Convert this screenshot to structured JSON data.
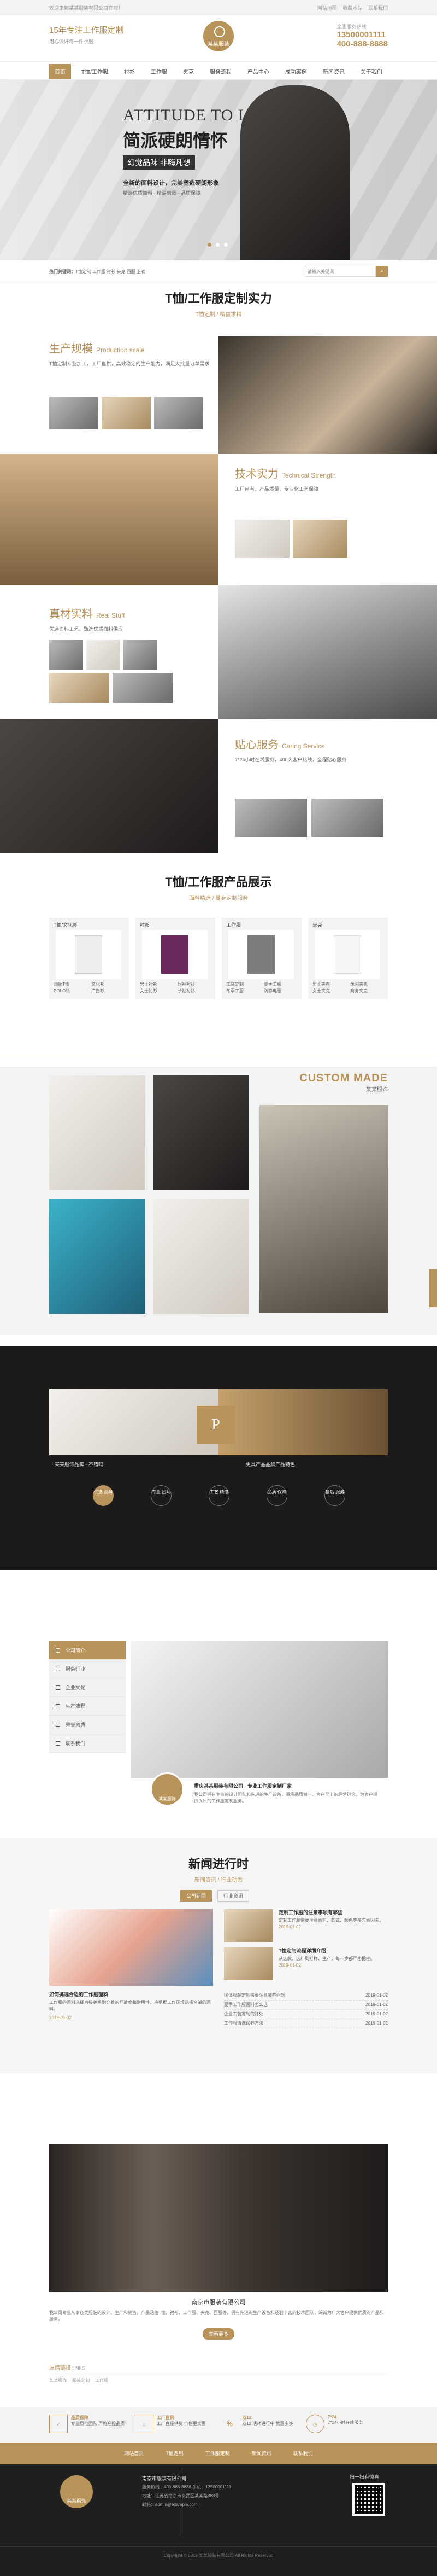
{
  "topbar": {
    "left": "欢迎来到某某服装有限公司官网！",
    "links": [
      "网站地图",
      "收藏本站",
      "联系我们"
    ]
  },
  "header": {
    "slogan": "15年专注工作服定制",
    "sub_slogan": "用心做好每一件衣服",
    "logo_text": "某某服装",
    "hotline_label": "全国服务热线",
    "phone1": "13500001111",
    "phone2": "400-888-8888"
  },
  "nav": {
    "items": [
      "首页",
      "T恤/工作服",
      "衬衫",
      "工作服",
      "夹克",
      "服务流程",
      "产品中心",
      "成功案例",
      "新闻资讯",
      "关于我们"
    ]
  },
  "banner": {
    "en_title": "ATTITUDE TO LIFE",
    "title": "简派硬朗情怀",
    "tag": "幻觉品味  非嗨凡想",
    "line1": "全新的面料设计，完美塑造硬朗形象",
    "line2": "精选优质面料 · 精湛剪裁 · 品质保障"
  },
  "search": {
    "label": "热门关键词：",
    "keywords": "T恤定制  工作服  衬衫  夹克  西服  卫衣",
    "placeholder": "请输入关键词",
    "button": "搜索"
  },
  "section1": {
    "title": "T恤/工作服定制实力",
    "subtitle": "T恤定制 / 精益求精",
    "features": [
      {
        "title": "生产规模",
        "en": "Production scale",
        "text": "T恤定制专业加工，工厂直供，高效稳定的生产能力，满足大批量订单需求"
      },
      {
        "title": "技术实力",
        "en": "Technical Strength",
        "text": "工厂自有，产品质量，专业化工艺保障"
      },
      {
        "title": "真材实料",
        "en": "Real Stuff",
        "text": "优选面料工艺，甄选优质面料供应"
      },
      {
        "title": "贴心服务",
        "en": "Caring Service",
        "text": "7*24小时在线服务，400大客户热线，全程贴心服务"
      }
    ]
  },
  "section2": {
    "title": "T恤/工作服产品展示",
    "subtitle": "面料精选 / 量身定制服务",
    "cols": [
      {
        "head": "T恤/文化衫",
        "items": [
          "圆领T恤",
          "POLO衫",
          "文化衫",
          "广告衫"
        ]
      },
      {
        "head": "衬衫",
        "items": [
          "男士衬衫",
          "女士衬衫",
          "短袖衬衫",
          "长袖衬衫"
        ]
      },
      {
        "head": "工作服",
        "items": [
          "工装定制",
          "冬季工服",
          "夏季工服",
          "防静电服"
        ]
      },
      {
        "head": "夹克",
        "items": [
          "男士夹克",
          "女士夹克",
          "休闲夹克",
          "商务夹克"
        ]
      }
    ]
  },
  "custom_made": {
    "en": "CUSTOM MADE",
    "cn": "某某服饰"
  },
  "dark_section": {
    "left_title": "某某服饰品牌 · 不错吗",
    "right_title": "更具产品品牌产品特色",
    "circles": [
      "优选 面料",
      "专业 团队",
      "工艺 精湛",
      "品质 保障",
      "售后 服务"
    ]
  },
  "about": {
    "menu": [
      "公司简介",
      "服务行业",
      "企业文化",
      "生产流程",
      "荣誉资质",
      "联系我们"
    ],
    "badge": "某某服饰",
    "title": "重庆某某服装有限公司 · 专业工作服定制厂家",
    "text": "我公司拥有专业的设计团队和先进的生产设备，秉承品质第一、客户至上的经营理念，为客户提供优质的工作服定制服务。"
  },
  "news": {
    "title": "新闻进行时",
    "subtitle": "新闻资讯 / 行业动态",
    "tabs": [
      "公司新闻",
      "行业资讯"
    ],
    "left_item": {
      "title": "如何挑选合适的工作服面料",
      "text": "工作服的面料选择直接关系到穿着的舒适度和耐用性，应根据工作环境选择合适的面料。",
      "date": "2019-01-02"
    },
    "right_items": [
      {
        "title": "定制工作服的注意事项有哪些",
        "text": "定制工作服需要注意面料、款式、颜色等多方面因素。",
        "date": "2019-01-02"
      },
      {
        "title": "T恤定制流程详细介绍",
        "text": "从选款、选料到打样、生产，每一步都严格把控。",
        "date": "2019-01-02"
      }
    ],
    "list": [
      {
        "title": "团体服装定制需要注意哪些问题",
        "date": "2019-01-02"
      },
      {
        "title": "夏季工作服面料怎么选",
        "date": "2019-01-02"
      },
      {
        "title": "企业工装定制的好处",
        "date": "2019-01-02"
      },
      {
        "title": "工作服清洗保养方法",
        "date": "2019-01-02"
      }
    ]
  },
  "company": {
    "name": "南京市服装有限公司",
    "desc": "我公司专业从事各类服装的设计、生产和销售，产品涵盖T恤、衬衫、工作服、夹克、西服等，拥有先进的生产设备和经验丰富的技术团队，竭诚为广大客户提供优质的产品和服务。",
    "button": "查看更多"
  },
  "links": {
    "label": "友情链接",
    "text": "LINKS",
    "items": [
      "某某服饰",
      "服装定制",
      "工作服"
    ]
  },
  "promises": [
    {
      "title": "品质保障",
      "text": "专业质检团队 严格把控品质"
    },
    {
      "title": "工厂直供",
      "text": "工厂直接供货 价格更实惠"
    },
    {
      "title": "双12",
      "text": "双12 活动进行中 优惠多多"
    },
    {
      "title": "7*24",
      "text": "7*24小时在线服务"
    }
  ],
  "footer_nav": [
    "网站首页",
    "T恤定制",
    "工作服定制",
    "新闻资讯",
    "联系我们"
  ],
  "footer": {
    "company": "南京市服装有限公司",
    "phone": "服务热线：400-888-8888   手机：13500001111",
    "address": "地址：江苏省南京市玄武区某某路888号",
    "email": "邮箱：admin@example.com",
    "qr_label": "扫一扫有惊喜",
    "logo_text": "某某服饰",
    "copyright": "Copyright © 2019 某某服装有限公司 All Rights Reserved"
  }
}
